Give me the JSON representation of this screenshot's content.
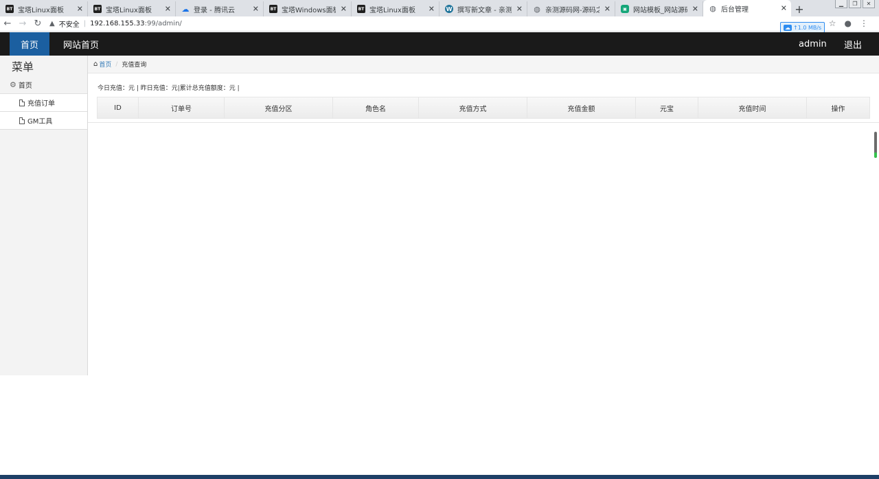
{
  "browser": {
    "tabs": [
      {
        "title": "宝塔Linux面板",
        "favicon": "BT",
        "favicon_type": "bt",
        "active": false
      },
      {
        "title": "宝塔Linux面板",
        "favicon": "BT",
        "favicon_type": "bt",
        "active": false
      },
      {
        "title": "登录 - 腾讯云",
        "favicon": "☁",
        "favicon_type": "cloud",
        "active": false
      },
      {
        "title": "宝塔Windows面板",
        "favicon": "BT",
        "favicon_type": "bt",
        "active": false
      },
      {
        "title": "宝塔Linux面板",
        "favicon": "BT",
        "favicon_type": "bt",
        "active": false
      },
      {
        "title": "撰写新文章 - 亲测源码网",
        "favicon": "W",
        "favicon_type": "wp",
        "active": false
      },
      {
        "title": "亲测源码网-源码之家",
        "favicon": "◍",
        "favicon_type": "globe",
        "active": false
      },
      {
        "title": "网站模板_网站源码下载",
        "favicon": "▣",
        "favicon_type": "green",
        "active": false
      },
      {
        "title": "后台管理",
        "favicon": "◍",
        "favicon_type": "globe",
        "active": true
      }
    ],
    "tab_close_glyph": "✕",
    "new_tab_glyph": "+",
    "address": {
      "security_label": "不安全",
      "host": "192.168.155.33",
      "path": ":99/admin/"
    },
    "speed_badge": "↑1.0 MB/s"
  },
  "header": {
    "home_label": "首页",
    "site_home_label": "网站首页",
    "user_label": "admin",
    "logout_label": "退出"
  },
  "sidebar": {
    "title": "菜单",
    "home_label": "首页",
    "items": [
      {
        "label": "充值订单"
      },
      {
        "label": "GM工具"
      }
    ]
  },
  "breadcrumb": {
    "home": "首页",
    "current": "充值查询"
  },
  "summary": "今日充值：元 | 昨日充值：元|累计总充值额度：元 |",
  "table": {
    "columns": [
      {
        "label": "ID"
      },
      {
        "label": "订单号"
      },
      {
        "label": "充值分区"
      },
      {
        "label": "角色名"
      },
      {
        "label": "充值方式"
      },
      {
        "label": "充值金额"
      },
      {
        "label": "元宝"
      },
      {
        "label": "充值时间"
      },
      {
        "label": "操作"
      }
    ]
  },
  "colors": {
    "header_bg": "#1a1a1a",
    "active_nav_bg": "#1b5fa0",
    "link": "#337ab7"
  }
}
